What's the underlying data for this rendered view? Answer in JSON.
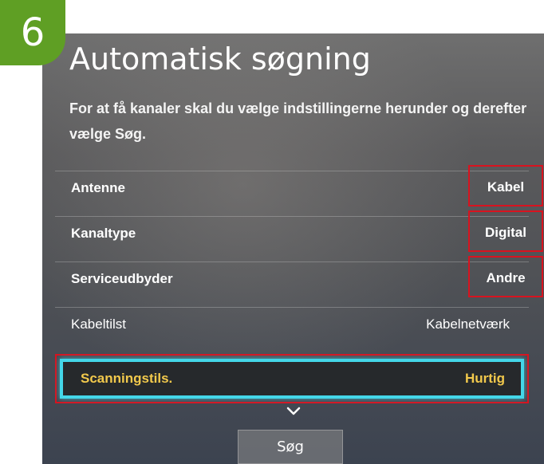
{
  "step": {
    "number": "6",
    "color": "#5f9f24"
  },
  "screen": {
    "title": "Automatisk søgning",
    "subtitle": "For at få kanaler skal du vælge indstillingerne herunder og derefter vælge Søg."
  },
  "settings": [
    {
      "label": "Antenne",
      "value": "Kabel"
    },
    {
      "label": "Kanaltype",
      "value": "Digital"
    },
    {
      "label": "Serviceudbyder",
      "value": "Andre"
    },
    {
      "label": "Kabeltilst",
      "value": "Kabelnetværk"
    },
    {
      "label": "Scanningstils.",
      "value": "Hurtig"
    }
  ],
  "more_indicator": "chevron-down-icon",
  "search_button": {
    "label": "Søg"
  },
  "colors": {
    "annotation_box": "#d8131f",
    "focus_outline": "#44d7e9",
    "selected_text": "#f2c94c"
  }
}
